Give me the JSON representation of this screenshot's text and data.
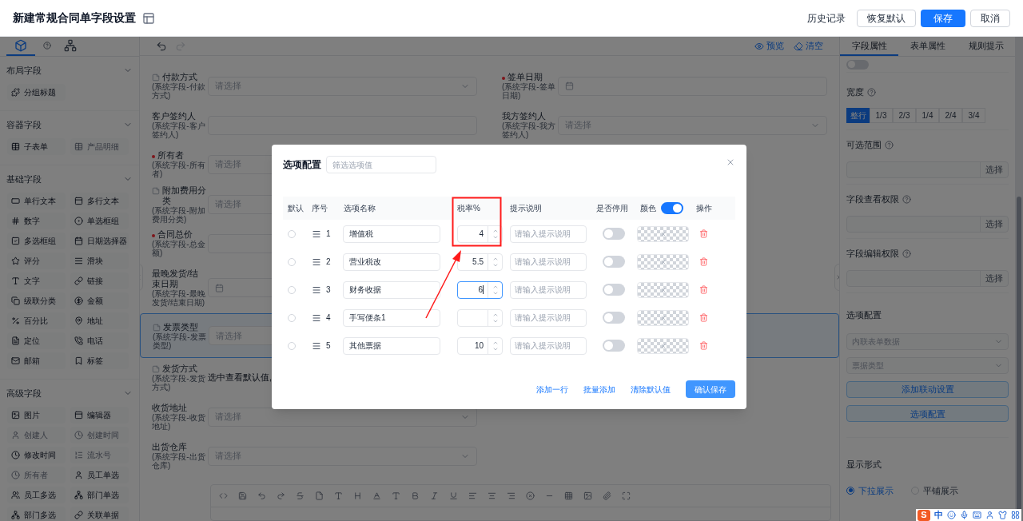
{
  "header": {
    "title": "新建常规合同单字段设置",
    "actions": [
      {
        "label": "历史记录",
        "kind": "link"
      },
      {
        "label": "恢复默认",
        "kind": "default"
      },
      {
        "label": "保存",
        "kind": "primary"
      },
      {
        "label": "取消",
        "kind": "default"
      }
    ]
  },
  "sidebar": {
    "tabs": [
      {
        "kind": "components",
        "selected": true
      },
      {
        "kind": "help",
        "selected": false
      },
      {
        "kind": "outline",
        "selected": false
      }
    ],
    "sections": [
      {
        "title": "布局字段",
        "expanded": true,
        "items": [
          {
            "label": "分组标题",
            "kind": "group",
            "disabled": false
          }
        ]
      },
      {
        "title": "容器字段",
        "expanded": true,
        "items": [
          {
            "label": "子表单",
            "kind": "subform",
            "disabled": false
          },
          {
            "label": "产品明细",
            "kind": "subform",
            "disabled": true
          }
        ]
      },
      {
        "title": "基础字段",
        "expanded": true,
        "items": [
          {
            "label": "单行文本",
            "kind": "single_line",
            "disabled": false
          },
          {
            "label": "多行文本",
            "kind": "multi_line",
            "disabled": false
          },
          {
            "label": "数字",
            "kind": "number",
            "disabled": false
          },
          {
            "label": "单选框组",
            "kind": "radio",
            "disabled": false
          },
          {
            "label": "多选框组",
            "kind": "checkbox",
            "disabled": false
          },
          {
            "label": "日期选择器",
            "kind": "date",
            "disabled": false
          },
          {
            "label": "评分",
            "kind": "rating",
            "disabled": false
          },
          {
            "label": "滑块",
            "kind": "slider",
            "disabled": false
          },
          {
            "label": "文字",
            "kind": "text",
            "disabled": false
          },
          {
            "label": "链接",
            "kind": "link",
            "disabled": false
          },
          {
            "label": "级联分类",
            "kind": "cascade",
            "disabled": false
          },
          {
            "label": "金额",
            "kind": "amount",
            "disabled": false
          },
          {
            "label": "百分比",
            "kind": "percent",
            "disabled": false
          },
          {
            "label": "地址",
            "kind": "address",
            "disabled": false
          },
          {
            "label": "定位",
            "kind": "location",
            "disabled": false
          },
          {
            "label": "电话",
            "kind": "phone",
            "disabled": false
          },
          {
            "label": "邮箱",
            "kind": "email",
            "disabled": false
          },
          {
            "label": "标签",
            "kind": "tag",
            "disabled": false
          }
        ]
      },
      {
        "title": "高级字段",
        "expanded": true,
        "items": [
          {
            "label": "图片",
            "kind": "image",
            "disabled": false
          },
          {
            "label": "编辑器",
            "kind": "editor",
            "disabled": false
          },
          {
            "label": "创建人",
            "kind": "user",
            "disabled": true
          },
          {
            "label": "创建时间",
            "kind": "clock",
            "disabled": true
          },
          {
            "label": "修改时间",
            "kind": "clock",
            "disabled": false
          },
          {
            "label": "流水号",
            "kind": "serial",
            "disabled": true
          },
          {
            "label": "所有者",
            "kind": "clock",
            "disabled": true
          },
          {
            "label": "员工单选",
            "kind": "user",
            "disabled": false
          },
          {
            "label": "员工多选",
            "kind": "users",
            "disabled": false
          },
          {
            "label": "部门单选",
            "kind": "department",
            "disabled": false
          },
          {
            "label": "部门多选",
            "kind": "department",
            "disabled": false
          },
          {
            "label": "关联单据",
            "kind": "link",
            "disabled": false
          }
        ]
      }
    ]
  },
  "canvas": {
    "toolbar": [
      {
        "label": "预览",
        "kind": "preview"
      },
      {
        "label": "清空",
        "kind": "clear"
      }
    ],
    "rows": [
      {
        "selected": false,
        "fields": [
          {
            "label": "付款方式",
            "hint": "(系统字段-付款方式)",
            "kind": "select",
            "doc": true,
            "required": false,
            "placeholder": "请选择"
          },
          {
            "label": "签单日期",
            "hint": "(系统字段-签单日期)",
            "kind": "date",
            "doc": false,
            "required": true
          }
        ]
      },
      {
        "selected": false,
        "fields": [
          {
            "label": "客户签约人",
            "hint": "(系统字段-客户签约人)",
            "kind": "input",
            "doc": false,
            "required": false
          },
          {
            "label": "我方签约人",
            "hint": "(系统字段-我方签约人)",
            "kind": "select",
            "doc": false,
            "required": false,
            "placeholder": "请选择"
          }
        ]
      },
      {
        "selected": false,
        "fields": [
          {
            "label": "所有者",
            "hint": "(系统字段-所有者)",
            "kind": "select",
            "doc": false,
            "required": true,
            "placeholder": "请选择"
          }
        ]
      },
      {
        "selected": false,
        "fields": [
          {
            "label": "附加费用分类",
            "hint": "(系统字段-附加费用分类)",
            "kind": "select",
            "doc": true,
            "required": false,
            "placeholder": "请选择"
          }
        ]
      },
      {
        "selected": false,
        "fields": [
          {
            "label": "合同总价",
            "hint": "(系统字段-总金额)",
            "kind": "input",
            "doc": false,
            "required": true
          }
        ]
      },
      {
        "selected": false,
        "fields": [
          {
            "label": "最晚发货/结束日期",
            "hint": "(系统字段-最晚发货/结束日期)",
            "kind": "date",
            "doc": false,
            "required": false
          }
        ]
      },
      {
        "selected": true,
        "fields": [
          {
            "label": "发票类型",
            "hint": "(系统字段-发票类型)",
            "kind": "select",
            "doc": true,
            "required": false,
            "placeholder": "请选择"
          }
        ]
      },
      {
        "selected": false,
        "fields": [
          {
            "label": "发货方式",
            "hint": "(系统字段-发货方式)",
            "kind": "text",
            "doc": true,
            "required": false,
            "value": "选中查看默认值,"
          }
        ]
      },
      {
        "selected": false,
        "fields": [
          {
            "label": "收货地址",
            "hint": "(系统字段-收货地址)",
            "kind": "select",
            "doc": false,
            "required": false,
            "placeholder": "请选择"
          }
        ]
      },
      {
        "selected": false,
        "fields": [
          {
            "label": "出货仓库",
            "hint": "(系统字段-出货仓库)",
            "kind": "select",
            "doc": false,
            "required": false,
            "placeholder": "请选择"
          }
        ]
      }
    ]
  },
  "properties": {
    "tabs": [
      {
        "label": "字段属性",
        "selected": true
      },
      {
        "label": "表单属性",
        "selected": false
      },
      {
        "label": "规则提示",
        "selected": false
      }
    ],
    "top_toggle": {
      "on": false
    },
    "width_label": "宽度",
    "widths": [
      {
        "label": "整行",
        "selected": true
      },
      {
        "label": "1/3",
        "selected": false
      },
      {
        "label": "2/3",
        "selected": false
      },
      {
        "label": "1/4",
        "selected": false
      },
      {
        "label": "2/4",
        "selected": false
      },
      {
        "label": "3/4",
        "selected": false
      }
    ],
    "pickers": [
      {
        "label": "可选范围",
        "button": "选择"
      },
      {
        "label": "字段查看权限",
        "button": "选择"
      },
      {
        "label": "字段编辑权限",
        "button": "选择"
      }
    ],
    "options_label": "选项配置",
    "selects": [
      {
        "placeholder": "内联表单数据"
      },
      {
        "placeholder": "票据类型"
      }
    ],
    "buttons": [
      "添加联动设置",
      "选项配置"
    ],
    "display_label": "显示形式",
    "display_options": [
      {
        "label": "下拉展示",
        "selected": true
      },
      {
        "label": "平铺展示",
        "selected": false
      }
    ]
  },
  "modal": {
    "title": "选项配置",
    "filter_placeholder": "筛选选项值",
    "columns": [
      "默认",
      "序号",
      "选项名称",
      "税率%",
      "提示说明",
      "是否停用",
      "颜色",
      "操作"
    ],
    "color_enabled": true,
    "rows": [
      {
        "selected": false,
        "index": "1",
        "name": "增值税",
        "rate": "4",
        "focused": false,
        "hint_placeholder": "请输入提示说明",
        "disabled": false
      },
      {
        "selected": false,
        "index": "2",
        "name": "营业税改",
        "rate": "5.5",
        "focused": false,
        "hint_placeholder": "请输入提示说明",
        "disabled": false
      },
      {
        "selected": false,
        "index": "3",
        "name": "财务收据",
        "rate": "6",
        "focused": true,
        "hint_placeholder": "请输入提示说明",
        "disabled": false
      },
      {
        "selected": false,
        "index": "4",
        "name": "手写便条1",
        "focused": false,
        "hint_placeholder": "请输入提示说明",
        "disabled": false
      },
      {
        "selected": false,
        "index": "5",
        "name": "其他票据",
        "rate": "10",
        "focused": false,
        "hint_placeholder": "请输入提示说明",
        "disabled": false
      }
    ],
    "links": [
      "添加一行",
      "批量添加",
      "清除默认值"
    ],
    "confirm": "确认保存"
  },
  "ime_toolbar": {
    "logo": "S",
    "mode": "中"
  }
}
